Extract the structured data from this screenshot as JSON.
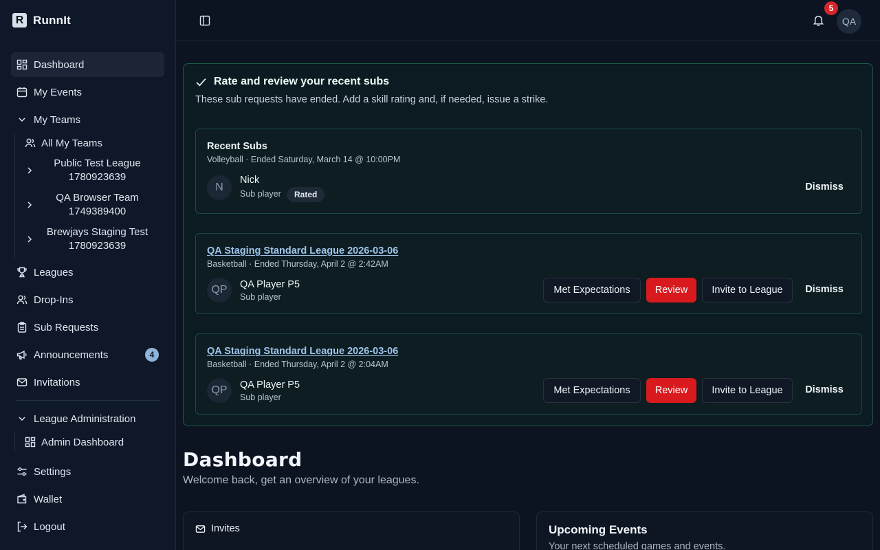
{
  "brand": {
    "logo_letter": "R",
    "name": "RunnIt"
  },
  "sidebar": {
    "items": [
      {
        "label": "Dashboard",
        "icon": "dashboard-icon"
      },
      {
        "label": "My Events",
        "icon": "calendar-icon"
      },
      {
        "label": "My Teams",
        "icon": "chevron-down-icon"
      },
      {
        "label": "Leagues",
        "icon": "trophy-icon"
      },
      {
        "label": "Drop-Ins",
        "icon": "users-icon"
      },
      {
        "label": "Sub Requests",
        "icon": "clipboard-icon"
      },
      {
        "label": "Announcements",
        "icon": "megaphone-icon",
        "badge": "4"
      },
      {
        "label": "Invitations",
        "icon": "mail-icon"
      },
      {
        "label": "League Administration",
        "icon": "chevron-down-icon"
      },
      {
        "label": "Settings",
        "icon": "sliders-icon"
      },
      {
        "label": "Wallet",
        "icon": "wallet-icon"
      },
      {
        "label": "Logout",
        "icon": "logout-icon"
      }
    ],
    "teams": {
      "all_label": "All My Teams",
      "list": [
        {
          "line1": "Public Test League",
          "line2": "1780923639"
        },
        {
          "line1": "QA Browser Team",
          "line2": "1749389400"
        },
        {
          "line1": "Brewjays Staging Test",
          "line2": "1780923639"
        }
      ]
    },
    "admin": {
      "dashboard_label": "Admin Dashboard"
    }
  },
  "topbar": {
    "notification_count": "5",
    "user_initials": "QA"
  },
  "review": {
    "title": "Rate and review your recent subs",
    "description": "These sub requests have ended. Add a skill rating and, if needed, issue a strike.",
    "cards": [
      {
        "heading": "Recent Subs",
        "meta": "Volleyball · Ended Saturday, March 14 @ 10:00PM",
        "initials": "N",
        "player": "Nick",
        "role": "Sub player",
        "rated_label": "Rated",
        "dismiss_label": "Dismiss"
      },
      {
        "heading": "QA Staging Standard League 2026-03-06",
        "meta": "Basketball · Ended Thursday, April 2 @ 2:42AM",
        "initials": "QP",
        "player": "QA Player P5",
        "role": "Sub player",
        "met_label": "Met Expectations",
        "review_label": "Review",
        "invite_label": "Invite to League",
        "dismiss_label": "Dismiss"
      },
      {
        "heading": "QA Staging Standard League 2026-03-06",
        "meta": "Basketball · Ended Thursday, April 2 @ 2:04AM",
        "initials": "QP",
        "player": "QA Player P5",
        "role": "Sub player",
        "met_label": "Met Expectations",
        "review_label": "Review",
        "invite_label": "Invite to League",
        "dismiss_label": "Dismiss"
      }
    ]
  },
  "dashboard": {
    "title": "Dashboard",
    "subtitle": "Welcome back, get an overview of your leagues.",
    "invites_title": "Invites",
    "upcoming_title": "Upcoming Events",
    "upcoming_subtitle": "Your next scheduled games and events."
  }
}
